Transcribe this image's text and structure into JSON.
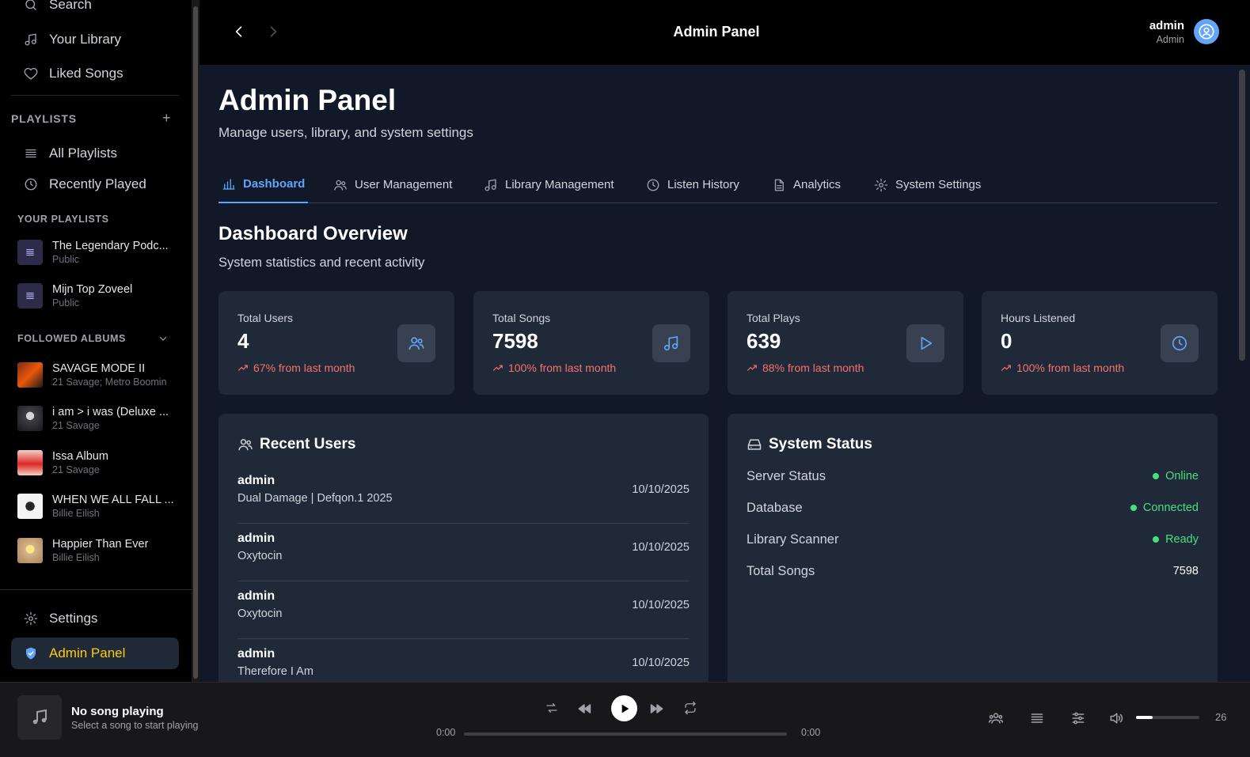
{
  "sidebar": {
    "nav": [
      {
        "label": "Search",
        "icon": "search-icon"
      },
      {
        "label": "Your Library",
        "icon": "music-note-icon"
      },
      {
        "label": "Liked Songs",
        "icon": "heart-icon"
      }
    ],
    "playlists_heading": "PLAYLISTS",
    "playlist_nav": [
      {
        "label": "All Playlists",
        "icon": "list-icon"
      },
      {
        "label": "Recently Played",
        "icon": "clock-icon"
      }
    ],
    "your_playlists_heading": "YOUR PLAYLISTS",
    "your_playlists": [
      {
        "title": "The Legendary Podc...",
        "sub": "Public"
      },
      {
        "title": "Mijn Top Zoveel",
        "sub": "Public"
      }
    ],
    "followed_albums_heading": "FOLLOWED ALBUMS",
    "followed_albums": [
      {
        "title": "SAVAGE MODE II",
        "artist": "21 Savage; Metro Boomin",
        "color": "#b45309"
      },
      {
        "title": "i am > i was (Deluxe ...",
        "artist": "21 Savage",
        "color": "#52525b"
      },
      {
        "title": "Issa Album",
        "artist": "21 Savage",
        "color": "#dc2626"
      },
      {
        "title": "WHEN WE ALL FALL ...",
        "artist": "Billie Eilish",
        "color": "#e4e4e7"
      },
      {
        "title": "Happier Than Ever",
        "artist": "Billie Eilish",
        "color": "#d6b48a"
      }
    ],
    "settings_label": "Settings",
    "admin_label": "Admin Panel",
    "accent_color": "#facc15"
  },
  "topbar": {
    "title": "Admin Panel",
    "user_name": "admin",
    "user_role": "Admin"
  },
  "page": {
    "title": "Admin Panel",
    "subtitle": "Manage users, library, and system settings",
    "tabs": [
      {
        "label": "Dashboard",
        "icon": "bar-chart-icon",
        "active": true
      },
      {
        "label": "User Management",
        "icon": "users-icon",
        "active": false
      },
      {
        "label": "Library Management",
        "icon": "music-note-icon",
        "active": false
      },
      {
        "label": "Listen History",
        "icon": "clock-icon",
        "active": false
      },
      {
        "label": "Analytics",
        "icon": "document-icon",
        "active": false
      },
      {
        "label": "System Settings",
        "icon": "gear-icon",
        "active": false
      }
    ],
    "section_title": "Dashboard Overview",
    "section_subtitle": "System statistics and recent activity"
  },
  "stats": [
    {
      "label": "Total Users",
      "value": "4",
      "trend": "67% from last month",
      "icon": "users-icon"
    },
    {
      "label": "Total Songs",
      "value": "7598",
      "trend": "100% from last month",
      "icon": "music-note-icon"
    },
    {
      "label": "Total Plays",
      "value": "639",
      "trend": "88% from last month",
      "icon": "play-icon"
    },
    {
      "label": "Hours Listened",
      "value": "0",
      "trend": "100% from last month",
      "icon": "clock-icon"
    }
  ],
  "recent_users": {
    "title": "Recent Users",
    "rows": [
      {
        "name": "admin",
        "song": "Dual Damage | Defqon.1 2025",
        "date": "10/10/2025"
      },
      {
        "name": "admin",
        "song": "Oxytocin",
        "date": "10/10/2025"
      },
      {
        "name": "admin",
        "song": "Oxytocin",
        "date": "10/10/2025"
      },
      {
        "name": "admin",
        "song": "Therefore I Am",
        "date": "10/10/2025"
      }
    ]
  },
  "system_status": {
    "title": "System Status",
    "rows": [
      {
        "label": "Server Status",
        "value": "Online"
      },
      {
        "label": "Database",
        "value": "Connected"
      },
      {
        "label": "Library Scanner",
        "value": "Ready"
      },
      {
        "label": "Total Songs",
        "value": "7598"
      }
    ]
  },
  "player": {
    "title": "No song playing",
    "subtitle": "Select a song to start playing",
    "time_current": "0:00",
    "time_total": "0:00",
    "volume": "26",
    "volume_fraction": 0.26
  }
}
